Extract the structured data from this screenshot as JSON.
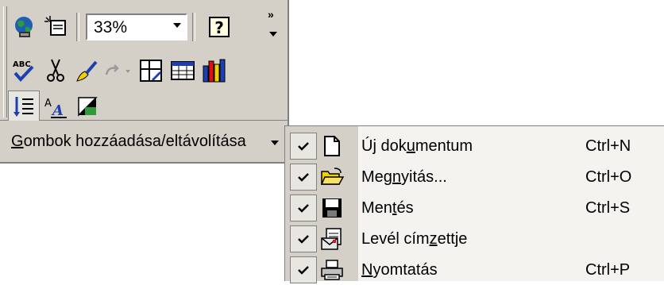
{
  "toolbar": {
    "zoom_value": "33%",
    "icons": {
      "web": "web-globe-icon",
      "doc_map": "document-map-icon",
      "help": "help-icon",
      "spell": "spelling-icon",
      "cut": "cut-icon",
      "format_painter": "format-painter-icon",
      "redo": "redo-icon",
      "insert_frame": "insert-frame-icon",
      "table": "insert-table-icon",
      "chart": "insert-chart-icon",
      "text_direction": "text-direction-icon",
      "change_case": "change-case-icon",
      "shading": "shading-icon"
    }
  },
  "add_remove": {
    "label_pre": "",
    "label_ul": "G",
    "label_post": "ombok hozzáadása/eltávolítása"
  },
  "menu": {
    "items": [
      {
        "pre": "Új dok",
        "ul": "u",
        "post": "mentum",
        "shortcut": "Ctrl+N",
        "icon": "new-document-icon",
        "checked": true
      },
      {
        "pre": "Meg",
        "ul": "n",
        "post": "yitás...",
        "shortcut": "Ctrl+O",
        "icon": "open-folder-icon",
        "checked": true
      },
      {
        "pre": "Men",
        "ul": "t",
        "post": "és",
        "shortcut": "Ctrl+S",
        "icon": "save-disk-icon",
        "checked": true
      },
      {
        "pre": "Levél cím",
        "ul": "z",
        "post": "ettje",
        "shortcut": "",
        "icon": "mail-recipient-icon",
        "checked": true
      },
      {
        "pre": "",
        "ul": "N",
        "post": "yomtatás",
        "shortcut": "Ctrl+P",
        "icon": "print-icon",
        "checked": true
      }
    ]
  },
  "colors": {
    "face": "#d4d0c8",
    "menu_bg": "#f4f3ef",
    "shadow": "#808080"
  }
}
